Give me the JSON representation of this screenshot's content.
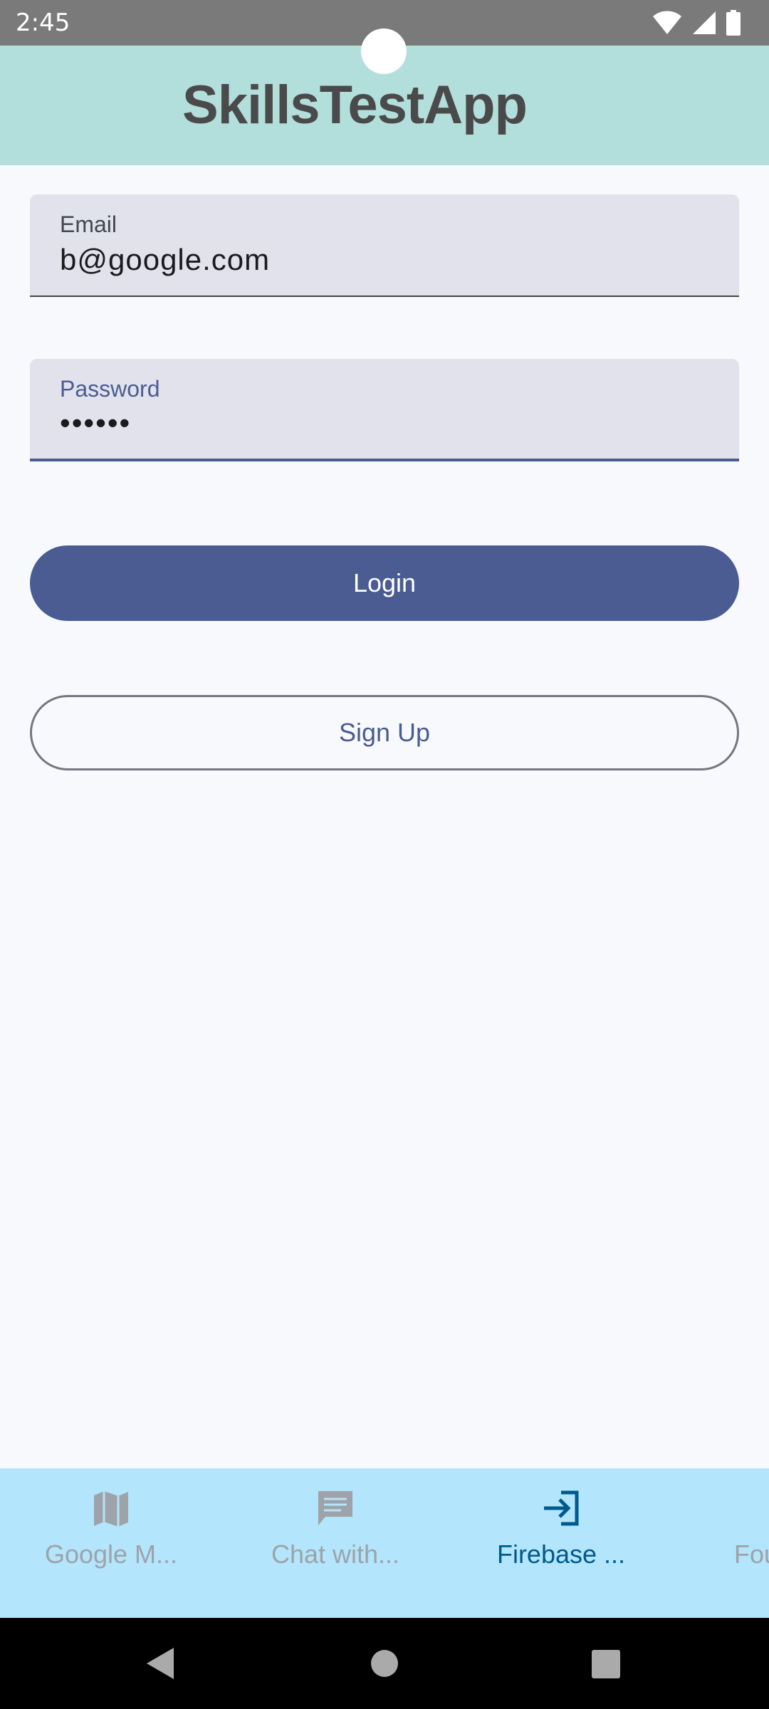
{
  "status_bar": {
    "time": "2:45",
    "icons": [
      "wifi-icon",
      "cell-signal-icon",
      "battery-icon"
    ]
  },
  "app_bar": {
    "title": "SkillsTestApp"
  },
  "form": {
    "email": {
      "label": "Email",
      "value": "b@google.com"
    },
    "password": {
      "label": "Password",
      "value": "••••••"
    }
  },
  "buttons": {
    "login": "Login",
    "signup": "Sign Up"
  },
  "bottom_nav": {
    "items": [
      {
        "label": "Google M...",
        "icon": "map-icon",
        "active": false
      },
      {
        "label": "Chat with...",
        "icon": "chat-icon",
        "active": false
      },
      {
        "label": "Firebase ...",
        "icon": "login-icon",
        "active": true
      },
      {
        "label": "Four",
        "icon": "more-icon",
        "active": false
      }
    ]
  },
  "system_nav": {
    "icons": [
      "back-icon",
      "home-icon",
      "recents-icon"
    ]
  },
  "colors": {
    "primary": "#4a5c92",
    "app_bar": "#b2dfdb",
    "bottom_nav": "#b3e5fc",
    "background": "#f8f9fd",
    "active_nav": "#005a8d"
  }
}
